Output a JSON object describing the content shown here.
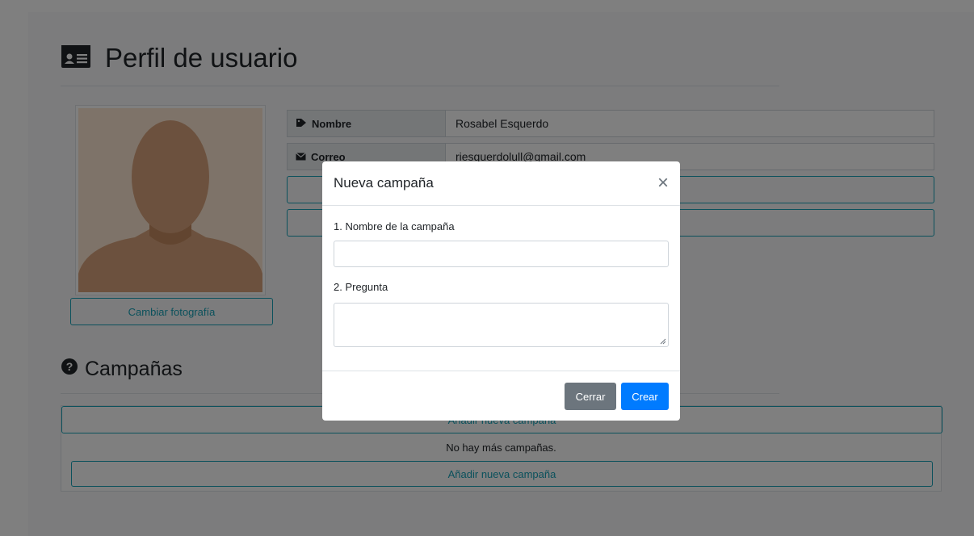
{
  "page": {
    "title": "Perfil de usuario",
    "title_icon": "id-card-icon"
  },
  "profile": {
    "change_photo_label": "Cambiar fotografía",
    "fields": [
      {
        "label": "Nombre",
        "icon": "tag-icon",
        "value": "Rosabel Esquerdo"
      },
      {
        "label": "Correo",
        "icon": "envelope-icon",
        "value": "riesquerdolull@gmail.com"
      }
    ]
  },
  "campaigns": {
    "title": "Campañas",
    "icon": "question-circle-icon",
    "add_label_top": "Añadir nueva campaña",
    "empty_text": "No hay más campañas.",
    "add_label_bottom": "Añadir nueva campaña"
  },
  "modal": {
    "title": "Nueva campaña",
    "close_symbol": "×",
    "field1_label": "1. Nombre de la campaña",
    "field1_value": "",
    "field2_label": "2. Pregunta",
    "field2_value": "",
    "close_button": "Cerrar",
    "create_button": "Crear"
  },
  "colors": {
    "primary": "#007bff",
    "secondary": "#6c757d",
    "info": "#17a2b8",
    "backdrop": "rgba(0,0,0,0.5)"
  }
}
